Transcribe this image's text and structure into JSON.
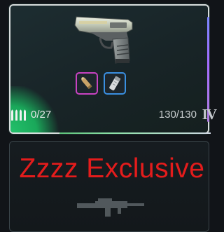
{
  "weapon_card": {
    "ammo": "0/27",
    "durability": "130/130",
    "rank": "IV",
    "icons": {
      "weapon": "pistol-icon",
      "attachment_1": "bullet-icon",
      "attachment_2": "grip-icon",
      "ammo": "ammo-icon"
    },
    "colors": {
      "border": "#d7dcdc",
      "corner_glow": "#23c16b",
      "slot_1_border": "#c843c2",
      "slot_2_border": "#3a8fe0"
    }
  },
  "locked_card": {
    "label": "Zzzz Exclusive",
    "label_color": "#e41c1c",
    "icon": "rifle-icon"
  }
}
